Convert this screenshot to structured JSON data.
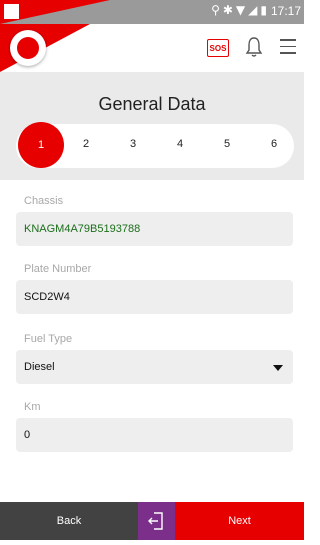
{
  "status_bar": {
    "time": "17:17",
    "icons": [
      "location-icon",
      "bluetooth-icon",
      "wifi-icon",
      "signal-icon",
      "battery-icon"
    ]
  },
  "app_bar": {
    "sos_label": "SOS",
    "icons": [
      "vodafone-logo",
      "sos-icon",
      "bell-icon",
      "menu-icon"
    ]
  },
  "page": {
    "title": "General Data"
  },
  "steps": [
    "1",
    "2",
    "3",
    "4",
    "5",
    "6"
  ],
  "active_step": "1",
  "fields": {
    "chassis": {
      "label": "Chassis",
      "value": "KNAGM4A79B5193788"
    },
    "plate": {
      "label": "Plate Number",
      "value": "SCD2W4"
    },
    "fuel": {
      "label": "Fuel Type",
      "value": "Diesel"
    },
    "km": {
      "label": "Km",
      "value": "0"
    }
  },
  "footer": {
    "back_label": "Back",
    "next_label": "Next"
  },
  "colors": {
    "brand_red": "#e60000",
    "exit_purple": "#7b2f8a",
    "back_dark": "#424242",
    "chassis_text_green": "#1b6e1b"
  }
}
